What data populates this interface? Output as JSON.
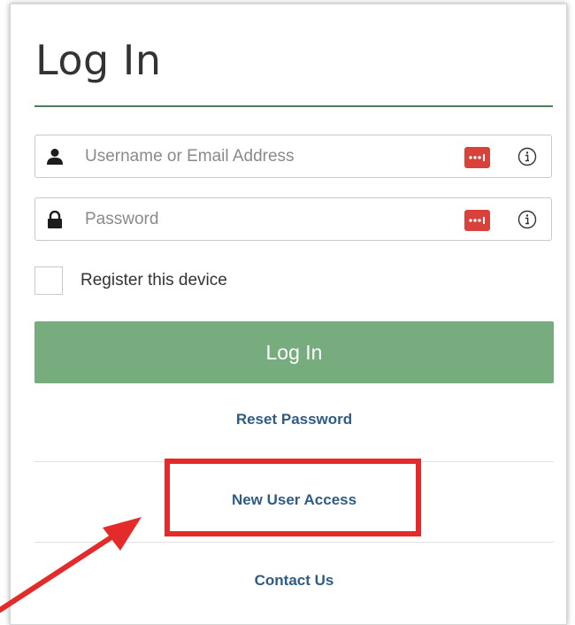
{
  "login": {
    "title": "Log In",
    "username": {
      "placeholder": "Username or Email Address",
      "value": ""
    },
    "password": {
      "placeholder": "Password",
      "value": ""
    },
    "register_device_label": "Register this device",
    "register_device_checked": false,
    "submit_label": "Log In",
    "links": {
      "reset_password": "Reset Password",
      "new_user_access": "New User Access",
      "contact_us": "Contact Us"
    }
  },
  "icons": {
    "username": "user-icon",
    "password": "lock-icon",
    "password_manager": "password-manager-icon",
    "info": "info-icon",
    "annotation_arrow": "arrow-icon"
  },
  "colors": {
    "title_rule": "#4f7d5c",
    "login_button": "#76ac7e",
    "link": "#2f5c86",
    "password_manager": "#d9413b",
    "highlight": "#e32b2b"
  }
}
